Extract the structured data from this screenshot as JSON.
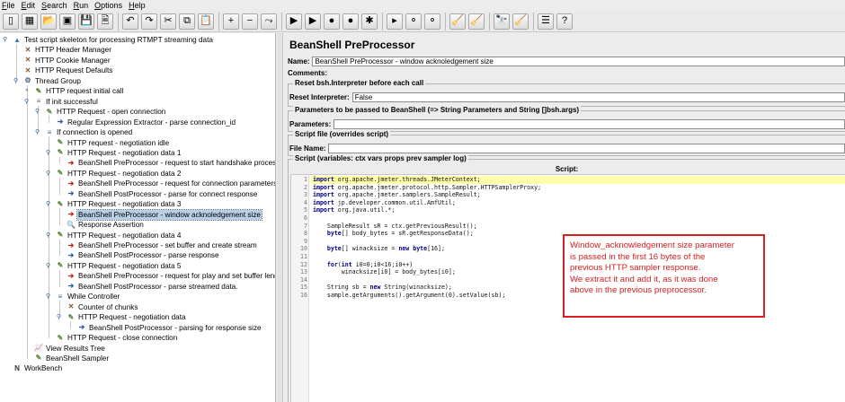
{
  "menubar": [
    "File",
    "Edit",
    "Search",
    "Run",
    "Options",
    "Help"
  ],
  "toolbar": {
    "groups": [
      [
        {
          "icon": "new-icon",
          "glyph": "▯"
        },
        {
          "icon": "templates-icon",
          "glyph": "▦"
        },
        {
          "icon": "open-icon",
          "glyph": "📂"
        },
        {
          "icon": "close-file-icon",
          "glyph": "▣"
        },
        {
          "icon": "save-icon",
          "glyph": "💾"
        },
        {
          "icon": "save-as-icon",
          "glyph": "🗎"
        }
      ],
      [
        {
          "icon": "undo-icon",
          "glyph": "↶"
        },
        {
          "icon": "redo-icon",
          "glyph": "↷"
        },
        {
          "icon": "cut-icon",
          "glyph": "✂"
        },
        {
          "icon": "copy-icon",
          "glyph": "⧉"
        },
        {
          "icon": "paste-icon",
          "glyph": "📋"
        }
      ],
      [
        {
          "icon": "expand-icon",
          "glyph": "+"
        },
        {
          "icon": "collapse-icon",
          "glyph": "−"
        },
        {
          "icon": "toggle-icon",
          "glyph": "⤳"
        }
      ],
      [
        {
          "icon": "start-icon",
          "glyph": "▶"
        },
        {
          "icon": "start-no-pause-icon",
          "glyph": "▶"
        },
        {
          "icon": "stop-icon",
          "glyph": "●"
        },
        {
          "icon": "shutdown-icon",
          "glyph": "●"
        },
        {
          "icon": "remote-icon",
          "glyph": "✱"
        }
      ],
      [
        {
          "icon": "remote-start-icon",
          "glyph": "▸"
        },
        {
          "icon": "remote-stop-icon",
          "glyph": "⚬"
        },
        {
          "icon": "remote-shutdown-icon",
          "glyph": "⚬"
        }
      ],
      [
        {
          "icon": "clear-icon",
          "glyph": "🧹"
        },
        {
          "icon": "clear-all-icon",
          "glyph": "🧹"
        }
      ],
      [
        {
          "icon": "search-icon",
          "glyph": "🔭"
        },
        {
          "icon": "reset-search-icon",
          "glyph": "🧹"
        }
      ],
      [
        {
          "icon": "function-helper-icon",
          "glyph": "☰"
        },
        {
          "icon": "help-icon",
          "glyph": "?"
        }
      ]
    ]
  },
  "tree": {
    "nodes": [
      {
        "label": "Test script skeleton for processing RTMPT streaming data",
        "depth": 0,
        "icon": "test-plan-icon",
        "glyph": "▲",
        "color": "#3c78b4",
        "handle": "minus"
      },
      {
        "label": "HTTP Header Manager",
        "depth": 1,
        "icon": "config-element-icon",
        "glyph": "✕",
        "color": "#8a5a2a",
        "handle": "none"
      },
      {
        "label": "HTTP Cookie Manager",
        "depth": 1,
        "icon": "config-element-icon",
        "glyph": "✕",
        "color": "#8a5a2a",
        "handle": "none"
      },
      {
        "label": "HTTP Request Defaults",
        "depth": 1,
        "icon": "config-element-icon",
        "glyph": "✕",
        "color": "#8a5a2a",
        "handle": "none"
      },
      {
        "label": "Thread Group",
        "depth": 1,
        "icon": "thread-group-icon",
        "glyph": "⚙",
        "color": "#4a6a8a",
        "handle": "minus"
      },
      {
        "label": "HTTP request initial call",
        "depth": 2,
        "icon": "sampler-icon",
        "glyph": "✎",
        "color": "#5a8a3a",
        "handle": "plus"
      },
      {
        "label": "If init successful",
        "depth": 2,
        "icon": "controller-icon",
        "glyph": "≡",
        "color": "#4a6a8a",
        "handle": "minus"
      },
      {
        "label": "HTTP Request - open connection",
        "depth": 3,
        "icon": "sampler-icon",
        "glyph": "✎",
        "color": "#5a8a3a",
        "handle": "minus"
      },
      {
        "label": "Regular Expression Extractor - parse connection_id",
        "depth": 4,
        "icon": "post-processor-icon",
        "glyph": "➔",
        "color": "#2a5aa8",
        "handle": "none"
      },
      {
        "label": "If connection is opened",
        "depth": 3,
        "icon": "controller-icon",
        "glyph": "≡",
        "color": "#4a6a8a",
        "handle": "minus"
      },
      {
        "label": "HTTP request - negotiation idle",
        "depth": 4,
        "icon": "sampler-icon",
        "glyph": "✎",
        "color": "#5a8a3a",
        "handle": "none"
      },
      {
        "label": "HTTP Request - negotiation data 1",
        "depth": 4,
        "icon": "sampler-icon",
        "glyph": "✎",
        "color": "#5a8a3a",
        "handle": "minus"
      },
      {
        "label": "BeanShell PreProcessor - request to start handshake process",
        "depth": 5,
        "icon": "pre-processor-icon",
        "glyph": "➔",
        "color": "#c02020",
        "handle": "none"
      },
      {
        "label": "HTTP Request - negotiation data 2",
        "depth": 4,
        "icon": "sampler-icon",
        "glyph": "✎",
        "color": "#5a8a3a",
        "handle": "minus"
      },
      {
        "label": "BeanShell PreProcessor - request for connection parameters",
        "depth": 5,
        "icon": "pre-processor-icon",
        "glyph": "➔",
        "color": "#c02020",
        "handle": "none"
      },
      {
        "label": "BeanShell PostProcessor - parse for connect response",
        "depth": 5,
        "icon": "post-processor-icon",
        "glyph": "➔",
        "color": "#2a5aa8",
        "handle": "none"
      },
      {
        "label": "HTTP Request - negotiation data 3",
        "depth": 4,
        "icon": "sampler-icon",
        "glyph": "✎",
        "color": "#5a8a3a",
        "handle": "minus"
      },
      {
        "label": "BeanShell PreProcessor - window acknoledgement size",
        "depth": 5,
        "icon": "pre-processor-icon",
        "glyph": "➔",
        "color": "#c02020",
        "handle": "none",
        "selected": true
      },
      {
        "label": "Response Assertion",
        "depth": 5,
        "icon": "assertion-icon",
        "glyph": "🔍",
        "color": "#5a7aa8",
        "handle": "none"
      },
      {
        "label": "HTTP Request - negotiation data 4",
        "depth": 4,
        "icon": "sampler-icon",
        "glyph": "✎",
        "color": "#5a8a3a",
        "handle": "minus"
      },
      {
        "label": "BeanShell PreProcessor - set buffer and create stream",
        "depth": 5,
        "icon": "pre-processor-icon",
        "glyph": "➔",
        "color": "#c02020",
        "handle": "none"
      },
      {
        "label": "BeanShell PostProcessor - parse response",
        "depth": 5,
        "icon": "post-processor-icon",
        "glyph": "➔",
        "color": "#2a5aa8",
        "handle": "none"
      },
      {
        "label": "HTTP Request - negotiation data 5",
        "depth": 4,
        "icon": "sampler-icon",
        "glyph": "✎",
        "color": "#5a8a3a",
        "handle": "minus"
      },
      {
        "label": "BeanShell PreProcessor - request for play and set buffer length",
        "depth": 5,
        "icon": "pre-processor-icon",
        "glyph": "➔",
        "color": "#c02020",
        "handle": "none"
      },
      {
        "label": "BeanShell PostProcessor - parse streamed data.",
        "depth": 5,
        "icon": "post-processor-icon",
        "glyph": "➔",
        "color": "#2a5aa8",
        "handle": "none"
      },
      {
        "label": "While Controller",
        "depth": 4,
        "icon": "controller-icon",
        "glyph": "≡",
        "color": "#4a6a8a",
        "handle": "minus"
      },
      {
        "label": "Counter of chunks",
        "depth": 5,
        "icon": "config-element-icon",
        "glyph": "✕",
        "color": "#8a5a2a",
        "handle": "none"
      },
      {
        "label": "HTTP Request - negotiation data",
        "depth": 5,
        "icon": "sampler-icon",
        "glyph": "✎",
        "color": "#5a8a3a",
        "handle": "minus"
      },
      {
        "label": "BeanShell PostProcessor - parsing for response size",
        "depth": 6,
        "icon": "post-processor-icon",
        "glyph": "➔",
        "color": "#2a5aa8",
        "handle": "none"
      },
      {
        "label": "HTTP Request - close connection",
        "depth": 4,
        "icon": "sampler-icon",
        "glyph": "✎",
        "color": "#5a8a3a",
        "handle": "none"
      },
      {
        "label": "View Results Tree",
        "depth": 2,
        "icon": "listener-icon",
        "glyph": "📈",
        "color": "#8a4a8a",
        "handle": "none"
      },
      {
        "label": "BeanShell Sampler",
        "depth": 2,
        "icon": "sampler-icon",
        "glyph": "✎",
        "color": "#5a8a3a",
        "handle": "none"
      },
      {
        "label": "WorkBench",
        "depth": 0,
        "icon": "workbench-icon",
        "glyph": "N",
        "color": "#333333",
        "handle": "none"
      }
    ]
  },
  "panel": {
    "title": "BeanShell PreProcessor",
    "name_label": "Name:",
    "name_value": "BeanShell PreProcessor - window acknoledgement size",
    "comments_label": "Comments:",
    "reset_group_title": "Reset bsh.Interpreter before each call",
    "reset_label": "Reset Interpreter:",
    "reset_value": "False",
    "params_group_title": "Parameters to be passed to BeanShell (=> String Parameters and String []bsh.args)",
    "params_label": "Parameters:",
    "params_value": "",
    "file_group_title": "Script file (overrides script)",
    "file_label": "File Name:",
    "file_value": "",
    "script_group_title": "Script (variables: ctx vars props prev sampler log)",
    "script_header": "Script:"
  },
  "script_lines": [
    "import org.apache.jmeter.threads.JMeterContext;",
    "import org.apache.jmeter.protocol.http.Sampler.HTTPSamplerProxy;",
    "import org.apache.jmeter.samplers.SampleResult;",
    "import jp.developer.common.util.AmfUtil;",
    "import org.java.util.*;",
    "",
    "    SampleResult sR = ctx.getPreviousResult();",
    "    byte[] body_bytes = sR.getResponseData();",
    "",
    "    byte[] winacksize = new byte[16];",
    "",
    "    for(int i0=0;i0<16;i0++)",
    "        winacksize[i0] = body_bytes[i0];",
    "",
    "    String sb = new String(winacksize);",
    "    sample.getArguments().getArgument(0).setValue(sb);"
  ],
  "highlight_line": 1,
  "callout": {
    "lines": [
      "Window_acknowledgement size parameter",
      "is passed in the first 16 bytes of the",
      "previous HTTP sampler response.",
      "We extract it and add it, as it was done",
      "above in the previous preprocessor."
    ]
  },
  "colors": {
    "callout_red": "#d42020",
    "selection": "#b8cfe5",
    "highlight_line": "#ffffaa"
  }
}
